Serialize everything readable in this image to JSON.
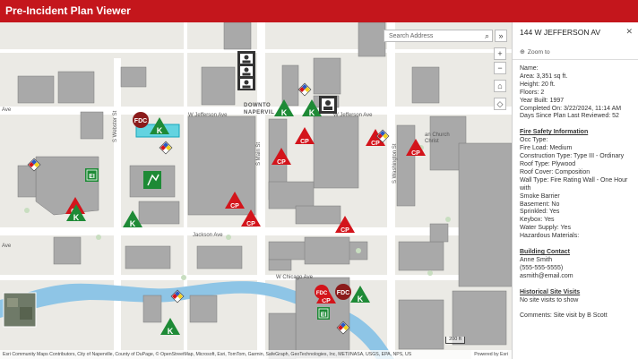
{
  "app": {
    "title": "Pre-Incident Plan Viewer"
  },
  "search": {
    "placeholder": "Search Address"
  },
  "map": {
    "attribution": "Esri Community Maps Contributors, City of Naperville, County of DuPage, © OpenStreetMap, Microsoft, Esri, TomTom, Garmin, SafeGraph, GeoTechnologies, Inc, METI/NASA, USGS, EPA, NPS, US",
    "powered_by": "Powered by Esri",
    "scale": "200 ft",
    "streets": {
      "jefferson": "W Jefferson Ave",
      "jefferson2": "W Jefferson Ave",
      "jackson": "Jackson Ave",
      "chicago": "W Chicago Ave",
      "webster": "S Webster St",
      "main": "S Main St",
      "washington": "S Washington St",
      "ave_left": "Ave",
      "ave_left2": "Ave",
      "downtown": "DOWNTO",
      "naperville": "NAPERVIL",
      "church": "an Church",
      "christ": "Christ"
    },
    "markers": {
      "cp": "CP",
      "k": "K",
      "fdc": "FDC",
      "ei": "EI"
    }
  },
  "panel": {
    "address": "144 W JEFFERSON AV",
    "close": "✕",
    "zoom_to": "Zoom to",
    "general": [
      "Name:",
      "Area: 3,351 sq ft.",
      "Height: 20 ft.",
      "Floors: 2",
      "Year Built: 1997",
      "Completed On: 3/22/2024, 11:14 AM",
      "Days Since Plan Last Reviewed: 52"
    ],
    "fire_safety_heading": "Fire Safety Information",
    "fire_safety": [
      "Occ Type:",
      "Fire Load: Medium",
      "Construction Type: Type III - Ordinary",
      "Roof Type: Plywood",
      "Roof Cover: Composition",
      "Wall Type: Fire Rating Wall - One Hour with",
      "Smoke Barrier",
      "Basement: No",
      "Sprinkled: Yes",
      "Keybox: Yes",
      "Water Supply: Yes",
      "Hazardous Materials:"
    ],
    "contact_heading": "Building Contact",
    "contact": [
      "Anne Smith",
      "(555-555-5555)",
      "asmith@email.com"
    ],
    "visits_heading": "Historical Site Visits",
    "visits": [
      "No site visits to show"
    ],
    "comments": "Comments: Site visit by B Scott"
  },
  "colors": {
    "header": "#c4161c",
    "cp": "#d3141b",
    "k": "#1e8a36",
    "ei": "#1e8a36",
    "building": "#a9a9a9",
    "river": "#8ec5e6"
  }
}
